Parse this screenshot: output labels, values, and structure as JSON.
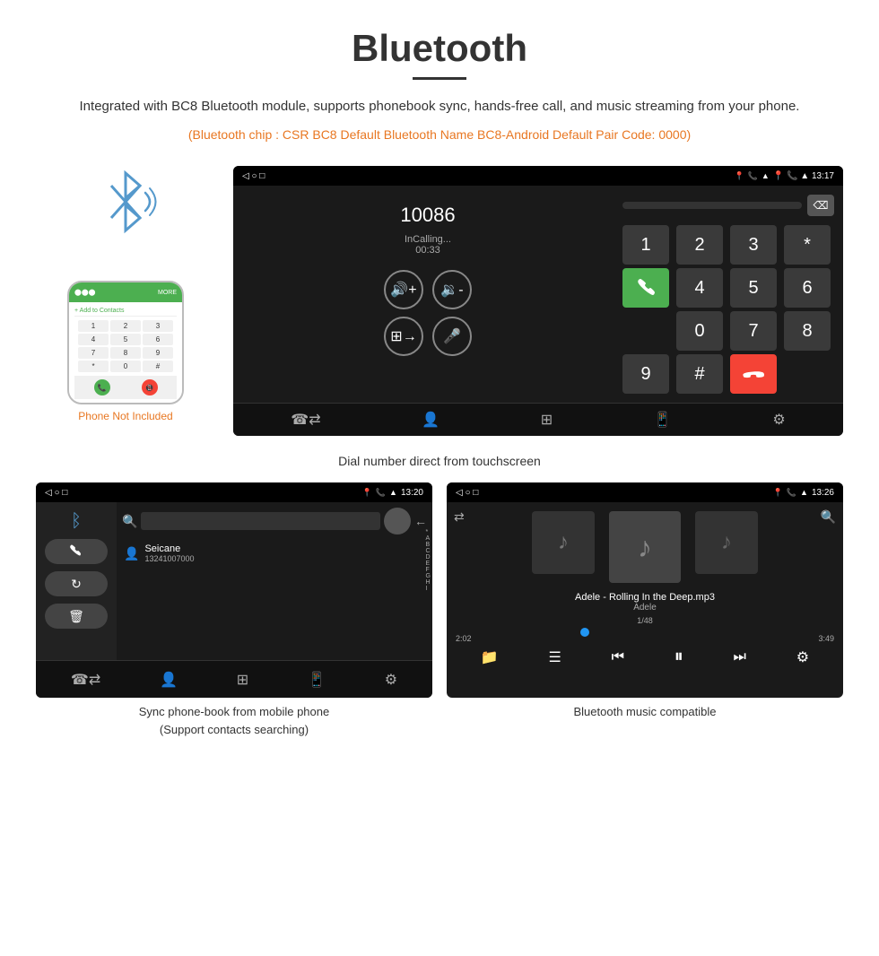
{
  "header": {
    "title": "Bluetooth",
    "underline": true,
    "description": "Integrated with BC8 Bluetooth module, supports phonebook sync, hands-free call, and music streaming from your phone.",
    "bluetooth_info": "(Bluetooth chip : CSR BC8    Default Bluetooth Name BC8-Android    Default Pair Code: 0000)"
  },
  "phone_mock": {
    "status": "MORE",
    "add_contacts": "+ Add to Contacts",
    "keys": [
      "1",
      "2",
      "3",
      "4",
      "5",
      "6",
      "7",
      "8",
      "9",
      "*",
      "0",
      "#"
    ],
    "call_icon": "📞",
    "end_icon": "📵"
  },
  "phone_label": "Phone Not Included",
  "dial_screen": {
    "status_bar": {
      "nav_icons": "◁  ○  □",
      "right_icons": "📍 📞 ▲ 13:17"
    },
    "number": "10086",
    "call_status": "InCalling...",
    "timer": "00:33",
    "keypad": {
      "keys": [
        "1",
        "2",
        "3",
        "*",
        "4",
        "5",
        "6",
        "0",
        "7",
        "8",
        "9",
        "#"
      ],
      "call_key": "☎",
      "end_key": "☎"
    },
    "bottom_icons": [
      "☎⇄",
      "👤",
      "⊞",
      "📱",
      "⚙"
    ]
  },
  "dial_caption": "Dial number direct from touchscreen",
  "phonebook_screen": {
    "status_bar": {
      "left": "◁  ○  □",
      "right": "📍 📞 ▲ 13:20"
    },
    "contact_name": "Seicane",
    "contact_number": "13241007000",
    "alphabet": [
      "*",
      "A",
      "B",
      "C",
      "D",
      "E",
      "F",
      "G",
      "H",
      "I"
    ],
    "bottom_icons": [
      "☎⇄",
      "👤",
      "⊞",
      "📱",
      "⚙"
    ]
  },
  "phonebook_caption": "Sync phone-book from mobile phone\n(Support contacts searching)",
  "music_screen": {
    "status_bar": {
      "left": "◁  ○  □",
      "right": "📍 📞 ▲ 13:26"
    },
    "song_title": "Adele - Rolling In the Deep.mp3",
    "artist": "Adele",
    "counter": "1/48",
    "time_current": "2:02",
    "time_total": "3:49",
    "progress_pct": 35,
    "bottom_icons": [
      "📁",
      "☰",
      "⏮",
      "⏸",
      "⏭",
      "⚙"
    ]
  },
  "music_caption": "Bluetooth music compatible",
  "icons": {
    "bluetooth": "ᛒ",
    "phone": "📞",
    "music_note": "♪",
    "search": "🔍",
    "back_arrow": "←",
    "shuffle": "⇄",
    "volume_up": "🔊",
    "volume_down": "🔉",
    "transfer": "⊞",
    "mic": "🎤",
    "person": "👤",
    "gear": "⚙",
    "grid": "⊞",
    "phone_transfer": "☎⇄",
    "delete": "🗑"
  }
}
